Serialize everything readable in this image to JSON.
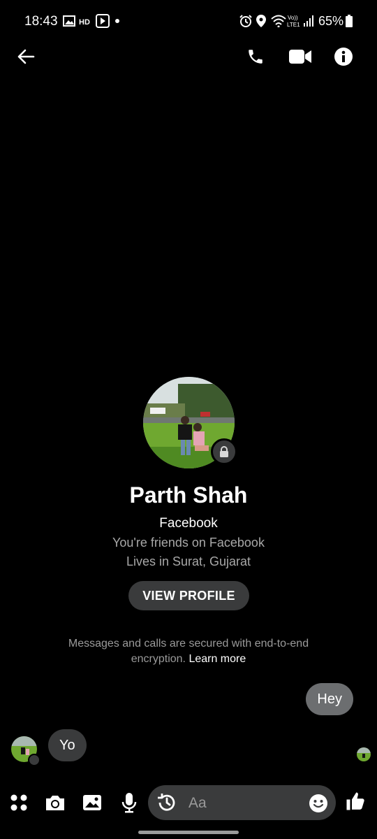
{
  "status_bar": {
    "time": "18:43",
    "battery": "65%",
    "left_icons": [
      "image-icon",
      "hd-icon",
      "media-icon",
      "dot-icon"
    ],
    "right_icons": [
      "alarm-icon",
      "location-icon",
      "wifi-icon",
      "volte-icon",
      "signal-icon",
      "battery-icon"
    ]
  },
  "header": {
    "back_icon": "back-arrow-icon",
    "actions": [
      "phone-icon",
      "video-icon",
      "info-icon"
    ]
  },
  "profile": {
    "name": "Parth Shah",
    "platform": "Facebook",
    "relationship": "You're friends on Facebook",
    "location": "Lives in Surat, Gujarat",
    "view_profile_label": "VIEW PROFILE"
  },
  "encryption": {
    "text": "Messages and calls are secured with end-to-end encryption.",
    "link": "Learn more"
  },
  "messages": [
    {
      "direction": "outgoing",
      "text": "Hey"
    },
    {
      "direction": "incoming",
      "text": "Yo"
    }
  ],
  "composer": {
    "placeholder": "Aa",
    "tools": [
      "menu-grid-icon",
      "camera-icon",
      "gallery-icon",
      "mic-icon"
    ],
    "inside_left_icon": "history-icon",
    "inside_right_icon": "emoji-icon",
    "send_icon": "thumbs-up-icon"
  },
  "colors": {
    "background": "#000000",
    "bubble_outgoing": "#6c6e70",
    "bubble_incoming": "#3a3b3c",
    "secondary_text": "#a8a8a8"
  }
}
